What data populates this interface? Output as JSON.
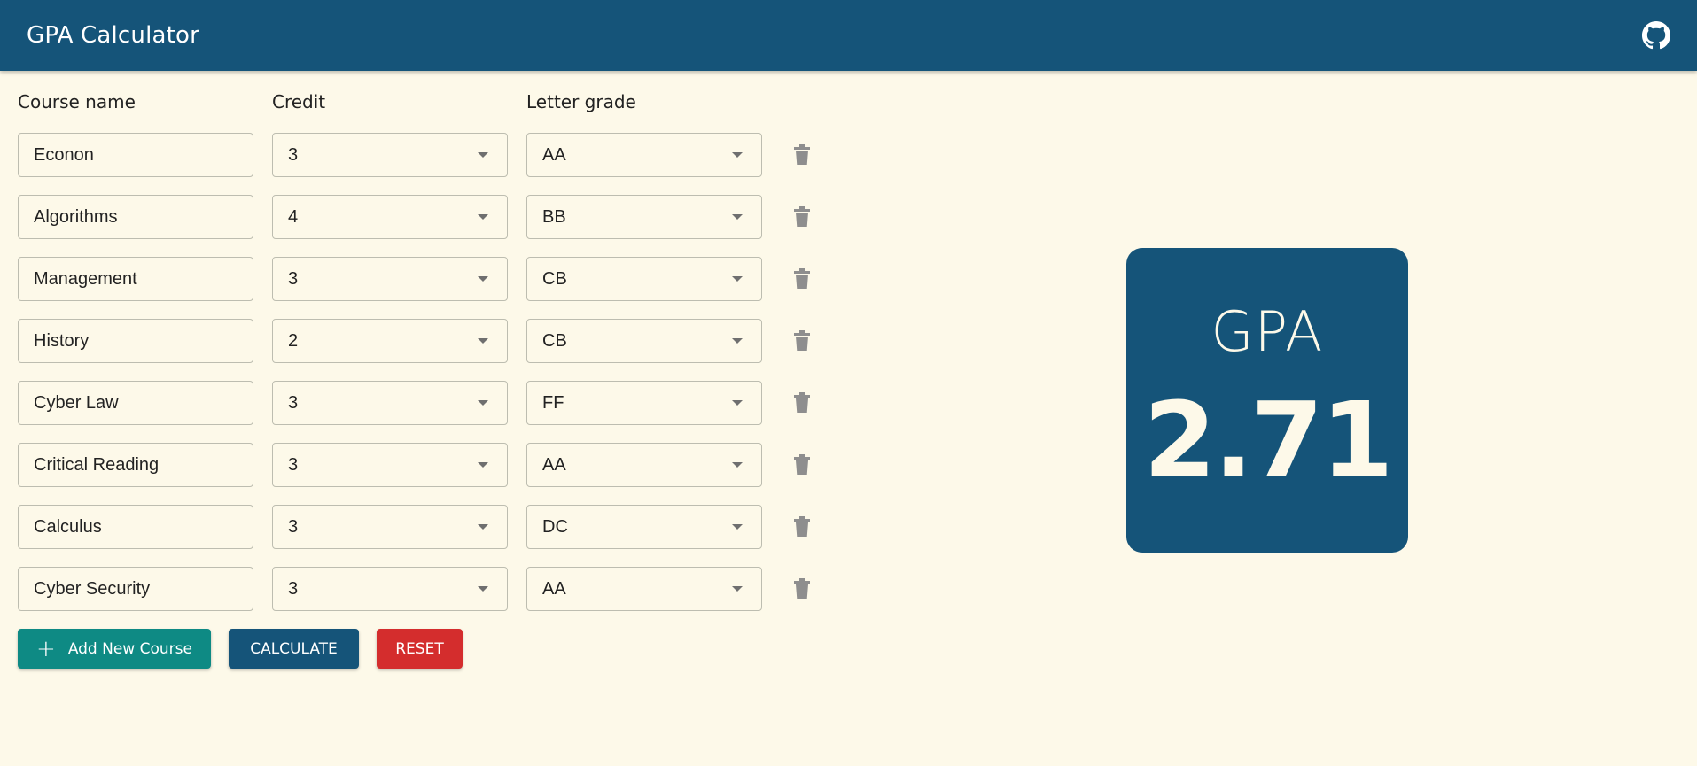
{
  "app": {
    "title": "GPA Calculator",
    "github_icon": "github-icon"
  },
  "columns": {
    "course_name": "Course name",
    "credit": "Credit",
    "letter_grade": "Letter grade"
  },
  "courses": [
    {
      "name": "Econon",
      "credit": "3",
      "grade": "AA"
    },
    {
      "name": "Algorithms",
      "credit": "4",
      "grade": "BB"
    },
    {
      "name": "Management",
      "credit": "3",
      "grade": "CB"
    },
    {
      "name": "History",
      "credit": "2",
      "grade": "CB"
    },
    {
      "name": "Cyber Law",
      "credit": "3",
      "grade": "FF"
    },
    {
      "name": "Critical Reading",
      "credit": "3",
      "grade": "AA"
    },
    {
      "name": "Calculus",
      "credit": "3",
      "grade": "DC"
    },
    {
      "name": "Cyber Security",
      "credit": "3",
      "grade": "AA"
    }
  ],
  "buttons": {
    "add_icon": "+",
    "add_label": "Add New Course",
    "calculate_label": "CALCULATE",
    "reset_label": "RESET"
  },
  "result": {
    "label": "GPA",
    "value": "2.71"
  },
  "colors": {
    "primary": "#155479",
    "background": "#fdf9e9",
    "add_button": "#0e8a84",
    "reset_button": "#d42d2d"
  }
}
